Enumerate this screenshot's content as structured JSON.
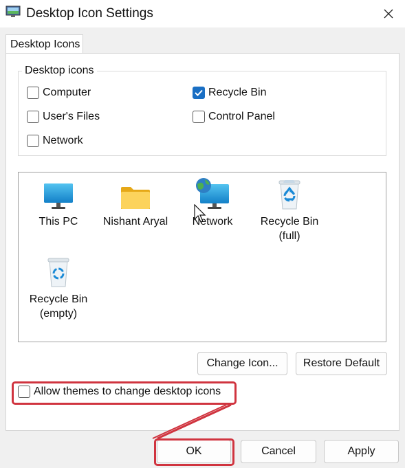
{
  "window": {
    "title": "Desktop Icon Settings",
    "close_glyph": "✕"
  },
  "tabs": [
    {
      "label": "Desktop Icons"
    }
  ],
  "desktop_icons_group": {
    "label": "Desktop icons",
    "checkboxes": [
      {
        "label": "Computer",
        "checked": false
      },
      {
        "label": "Recycle Bin",
        "checked": true
      },
      {
        "label": "User's Files",
        "checked": false
      },
      {
        "label": "Control Panel",
        "checked": false
      },
      {
        "label": "Network",
        "checked": false
      }
    ]
  },
  "icon_list": [
    {
      "label": "This PC",
      "icon": "monitor-icon"
    },
    {
      "label": "Nishant Aryal",
      "icon": "folder-icon"
    },
    {
      "label": "Network",
      "icon": "network-icon"
    },
    {
      "label": "Recycle Bin\n(full)",
      "line1": "Recycle Bin",
      "line2": "(full)",
      "icon": "recycle-bin-full-icon"
    },
    {
      "label": "Recycle Bin\n(empty)",
      "line1": "Recycle Bin",
      "line2": "(empty)",
      "icon": "recycle-bin-empty-icon"
    }
  ],
  "buttons": {
    "change_icon": "Change Icon...",
    "restore_default": "Restore Default",
    "ok": "OK",
    "cancel": "Cancel",
    "apply": "Apply"
  },
  "allow_themes": {
    "label": "Allow themes to change desktop icons",
    "checked": false
  },
  "colors": {
    "accent": "#1a6fc4",
    "annotation": "#d0343f"
  }
}
